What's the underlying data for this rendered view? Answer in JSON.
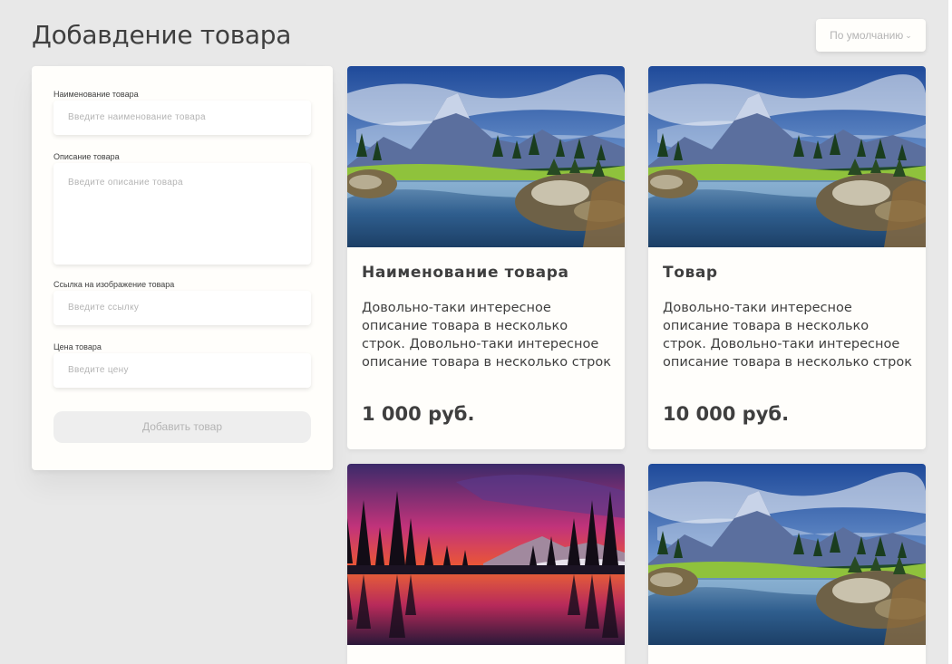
{
  "page": {
    "title": "Добавдение товара"
  },
  "sort": {
    "selected": "По умолчанию",
    "icon": "chevron-down-icon"
  },
  "form": {
    "name_label": "Наименование товара",
    "name_placeholder": "Введите наименование товара",
    "description_label": "Описание товара",
    "description_placeholder": "Введите описание товара",
    "image_label": "Ссылка на изображение товара",
    "image_placeholder": "Введите ссылку",
    "price_label": "Цена товара",
    "price_placeholder": "Введите цену",
    "submit_label": "Добавить товар"
  },
  "products": [
    {
      "name": "Наименование товара",
      "description": "Довольно-таки интересное описание товара в несколько строк. Довольно-таки интересное описание товара в несколько строк",
      "price": "1 000 руб.",
      "image": "mountain-lake-photo"
    },
    {
      "name": "Товар",
      "description": "Довольно-таки интересное описание товара в несколько строк. Довольно-таки интересное описание товара в несколько строк",
      "price": "10 000 руб.",
      "image": "mountain-lake-photo"
    },
    {
      "image": "sunset-lake-photo"
    },
    {
      "image": "mountain-lake-photo"
    }
  ],
  "colors": {
    "background": "#e8e8e8",
    "panel": "#fffefb",
    "text": "#3f3f3f",
    "placeholder": "#b4b4b4",
    "button_disabled": "#eeeeee"
  }
}
